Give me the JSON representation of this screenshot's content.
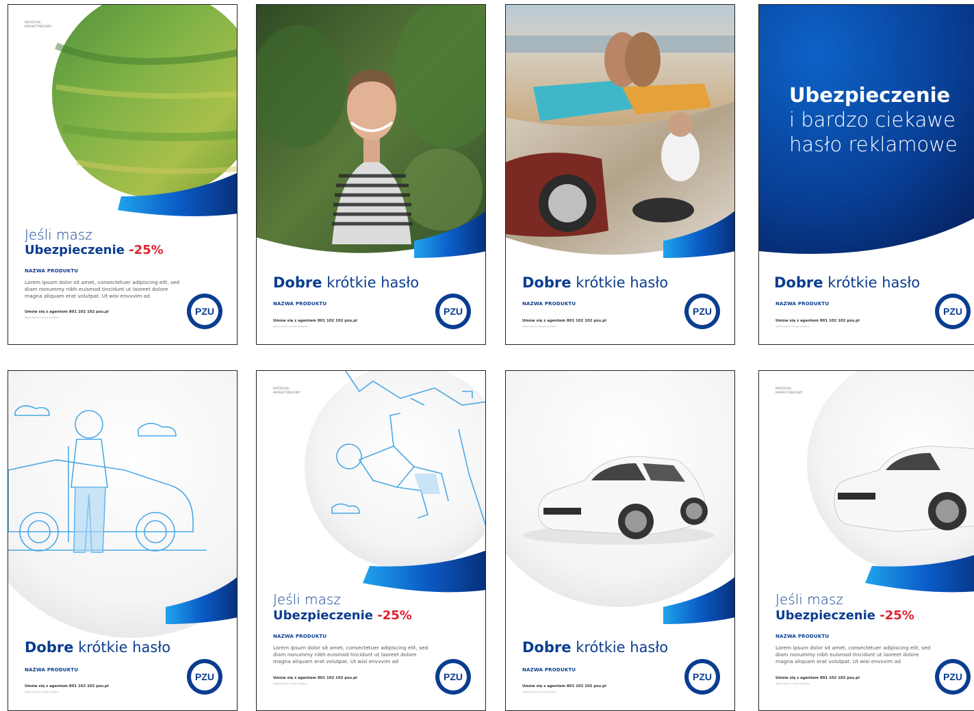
{
  "material_label": "MATERIAŁ\nMARKETINGOWY",
  "headline_light": "Jeśli masz",
  "headline_bold": "Ubezpieczenie",
  "headline_discount": "-25%",
  "tagline_bold": "Dobre",
  "tagline_rest": "krótkie hasło",
  "product_name": "NAZWA PRODUKTU",
  "body_text": "Lorem ipsum dolor sit amet, consectetuer adipiscing elit, sed diam nonummy nibh euismod tincidunt ut laoreet dolore magna aliquam erat volutpat. Ut wisi envvvim ad",
  "contact": "Umów się z agentem  801 102 102  pzu.pl",
  "contact_small": "Opłata zgodna z taryfą operatora",
  "blue_title_bold": "Ubezpieczenie",
  "blue_title_line2": "i bardzo ciekawe",
  "blue_title_line3": "hasło reklamowe",
  "logo_text": "PZU",
  "colors": {
    "navy": "#0a3d8f",
    "red": "#e0202e",
    "blue_light": "#1b8fe0",
    "dark_blue": "#062a6b"
  }
}
